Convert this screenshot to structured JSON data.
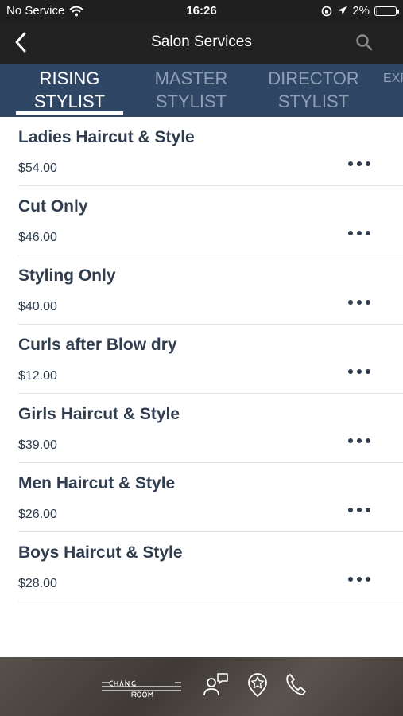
{
  "status": {
    "carrier": "No Service",
    "time": "16:26",
    "battery": "2%",
    "battery_level": 0.02
  },
  "nav": {
    "title": "Salon Services"
  },
  "tabs": [
    {
      "line1": "RISING",
      "line2": "STYLIST"
    },
    {
      "line1": "MASTER",
      "line2": "STYLIST"
    },
    {
      "line1": "DIRECTOR",
      "line2": "STYLIST"
    },
    {
      "line1": "EXP",
      "line2": ""
    }
  ],
  "services": [
    {
      "name": "Ladies Haircut & Style",
      "price": "$54.00"
    },
    {
      "name": "Cut Only",
      "price": "$46.00"
    },
    {
      "name": "Styling Only",
      "price": "$40.00"
    },
    {
      "name": "Curls after Blow dry",
      "price": "$12.00"
    },
    {
      "name": "Girls Haircut & Style",
      "price": "$39.00"
    },
    {
      "name": "Men Haircut & Style",
      "price": "$26.00"
    },
    {
      "name": "Boys Haircut & Style",
      "price": "$28.00"
    }
  ],
  "footer": {
    "logo_text": "CHANGING ROOM",
    "icons": [
      "chat-person-icon",
      "star-badge-icon",
      "phone-icon"
    ]
  },
  "colors": {
    "tab_bar": "#2f4664",
    "text": "#2f3d4f",
    "nav": "#222222"
  }
}
